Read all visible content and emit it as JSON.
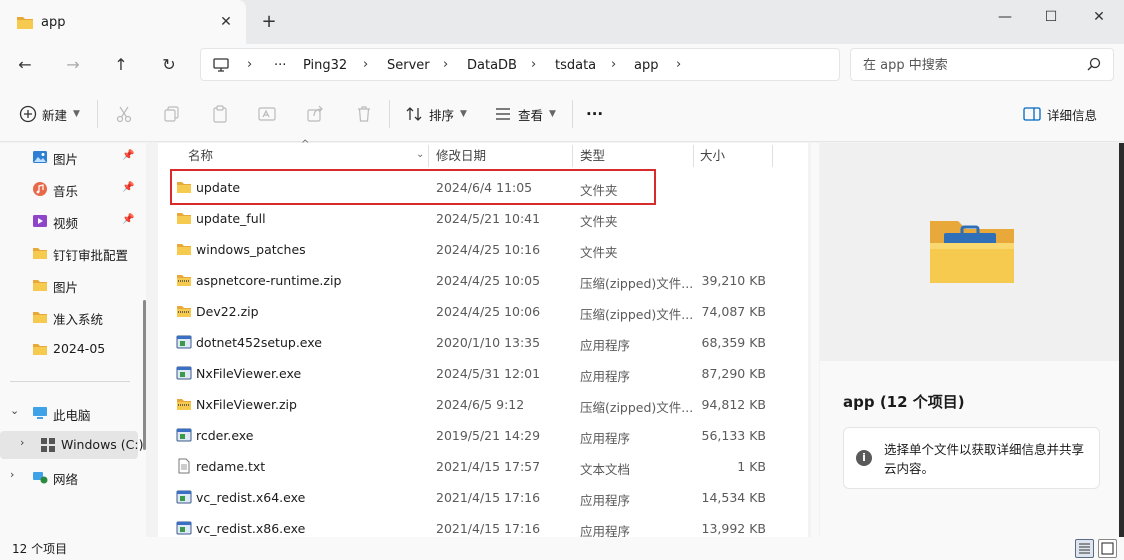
{
  "tab": {
    "title": "app",
    "close": "✕",
    "new": "+"
  },
  "window_controls": {
    "minimize": "—",
    "maximize": "☐",
    "close": "✕"
  },
  "nav": {
    "back": "←",
    "forward": "→",
    "up": "↑",
    "refresh": "↻",
    "more": "···",
    "breadcrumbs": [
      "Ping32",
      "Server",
      "DataDB",
      "tsdata",
      "app"
    ],
    "sep": "›"
  },
  "search": {
    "placeholder": "在 app 中搜索"
  },
  "toolbar": {
    "new_label": "新建",
    "sort_label": "排序",
    "view_label": "查看",
    "more_label": "···",
    "details_label": "详细信息"
  },
  "sidebar": {
    "quick": [
      {
        "label": "图片",
        "icon": "pictures-icon",
        "pinned": true
      },
      {
        "label": "音乐",
        "icon": "music-icon",
        "pinned": true
      },
      {
        "label": "视频",
        "icon": "video-icon",
        "pinned": true
      },
      {
        "label": "钉钉审批配置",
        "icon": "folder-icon",
        "pinned": false
      },
      {
        "label": "图片",
        "icon": "folder-icon",
        "pinned": false
      },
      {
        "label": "准入系统",
        "icon": "folder-icon",
        "pinned": false
      },
      {
        "label": "2024-05",
        "icon": "folder-icon",
        "pinned": false
      }
    ],
    "this_pc": "此电脑",
    "windows_drive": "Windows (C:)",
    "network": "网络"
  },
  "columns": {
    "name": "名称",
    "date": "修改日期",
    "type": "类型",
    "size": "大小"
  },
  "files": [
    {
      "name": "update",
      "date": "2024/6/4 11:05",
      "type": "文件夹",
      "size": "",
      "icon": "folder"
    },
    {
      "name": "update_full",
      "date": "2024/5/21 10:41",
      "type": "文件夹",
      "size": "",
      "icon": "folder"
    },
    {
      "name": "windows_patches",
      "date": "2024/4/25 10:16",
      "type": "文件夹",
      "size": "",
      "icon": "folder"
    },
    {
      "name": "aspnetcore-runtime.zip",
      "date": "2024/4/25 10:05",
      "type": "压缩(zipped)文件...",
      "size": "39,210 KB",
      "icon": "zip"
    },
    {
      "name": "Dev22.zip",
      "date": "2024/4/25 10:06",
      "type": "压缩(zipped)文件...",
      "size": "74,087 KB",
      "icon": "zip"
    },
    {
      "name": "dotnet452setup.exe",
      "date": "2020/1/10 13:35",
      "type": "应用程序",
      "size": "68,359 KB",
      "icon": "exe"
    },
    {
      "name": "NxFileViewer.exe",
      "date": "2024/5/31 12:01",
      "type": "应用程序",
      "size": "87,290 KB",
      "icon": "exe"
    },
    {
      "name": "NxFileViewer.zip",
      "date": "2024/6/5 9:12",
      "type": "压缩(zipped)文件...",
      "size": "94,812 KB",
      "icon": "zip"
    },
    {
      "name": "rcder.exe",
      "date": "2019/5/21 14:29",
      "type": "应用程序",
      "size": "56,133 KB",
      "icon": "exe"
    },
    {
      "name": "redame.txt",
      "date": "2021/4/15 17:57",
      "type": "文本文档",
      "size": "1 KB",
      "icon": "txt"
    },
    {
      "name": "vc_redist.x64.exe",
      "date": "2021/4/15 17:16",
      "type": "应用程序",
      "size": "14,534 KB",
      "icon": "exe"
    },
    {
      "name": "vc_redist.x86.exe",
      "date": "2021/4/15 17:16",
      "type": "应用程序",
      "size": "13,992 KB",
      "icon": "exe"
    }
  ],
  "details": {
    "title": "app (12 个项目)",
    "info": "选择单个文件以获取详细信息并共享云内容。"
  },
  "status": {
    "count": "12 个项目"
  },
  "colors": {
    "folder": "#f2c14e",
    "highlight": "#d92b2b",
    "accent": "#0067c0"
  }
}
